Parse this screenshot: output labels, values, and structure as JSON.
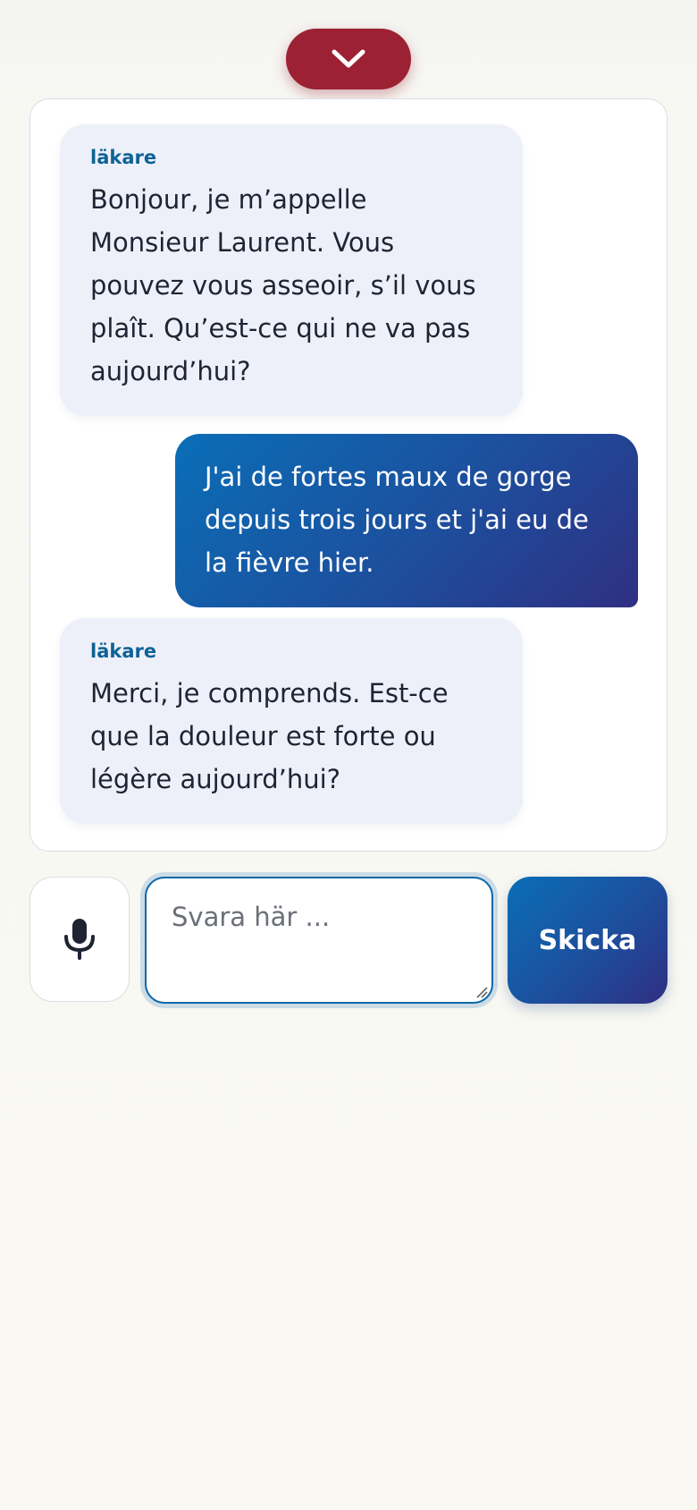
{
  "header": {
    "collapse_icon": "chevron-down-icon",
    "collapse_color": "#9c2133"
  },
  "chat": {
    "messages": [
      {
        "role": "doctor",
        "sender": "läkare",
        "text": "Bonjour, je m’appelle Monsieur Laurent. Vous pouvez vous asseoir, s’il vous plaît. Qu’est-ce qui ne va pas aujourd’hui?"
      },
      {
        "role": "user",
        "text": "J'ai de fortes maux de gorge depuis trois jours et j'ai eu de la fièvre hier."
      },
      {
        "role": "doctor",
        "sender": "läkare",
        "text": "Merci, je comprends. Est-ce que la douleur est forte ou légère aujourd’hui?"
      }
    ]
  },
  "composer": {
    "mic_icon": "microphone-icon",
    "input_value": "",
    "input_placeholder": "Svara här ...",
    "send_label": "Skicka"
  },
  "colors": {
    "accent_blue": "#0a6eb7",
    "accent_indigo": "#2f2f82",
    "sender_label": "#0e6396",
    "doctor_bubble": "#eef0f9"
  }
}
